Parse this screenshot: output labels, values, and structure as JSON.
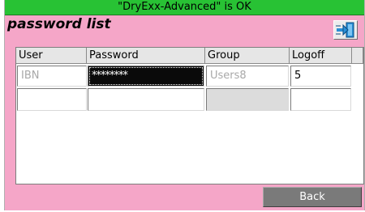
{
  "status_bar": {
    "text": "\"DryExx-Advanced\" is OK"
  },
  "page": {
    "title": "password list"
  },
  "table": {
    "headers": [
      "User",
      "Password",
      "Group",
      "Logoff time"
    ],
    "rows": [
      {
        "user": "IBN",
        "password": "********",
        "group": "Users8",
        "logoff_time": "5"
      },
      {
        "user": "",
        "password": "",
        "group": "",
        "logoff_time": ""
      }
    ]
  },
  "buttons": {
    "back": "Back",
    "exit_icon": "exit-door-icon"
  },
  "colors": {
    "background": "#f5a6c8",
    "status_bar": "#28c234",
    "back_button": "#7a7a7a"
  }
}
